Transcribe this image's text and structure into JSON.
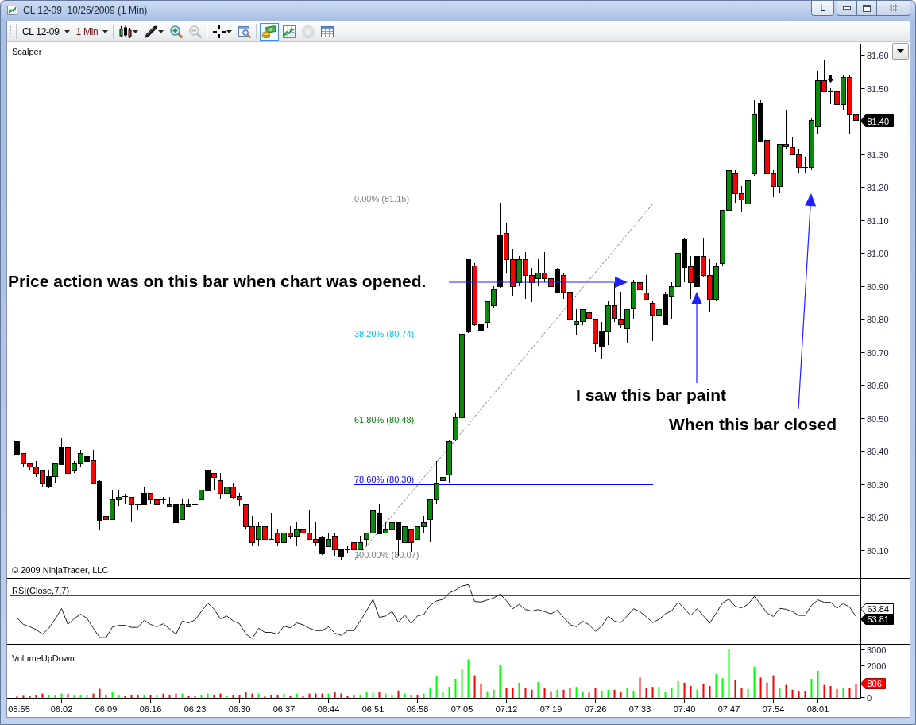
{
  "window": {
    "title": "CL 12-09  10/26/2009 (1 Min)",
    "buttons": [
      {
        "kind": "text",
        "label": "L"
      },
      {
        "kind": "minimize"
      },
      {
        "kind": "maximize"
      },
      {
        "kind": "close"
      }
    ]
  },
  "toolbar": {
    "instrument": "CL 12-09",
    "interval": "1 Min",
    "tool_groups": [
      [
        {
          "kind": "chart-style",
          "dropdown": true,
          "selected": false,
          "disabled": false
        },
        {
          "kind": "drawing-tools",
          "dropdown": true,
          "selected": false,
          "disabled": false
        },
        {
          "kind": "zoom-in",
          "dropdown": false,
          "selected": false,
          "disabled": false
        },
        {
          "kind": "zoom-out",
          "dropdown": false,
          "selected": false,
          "disabled": true
        }
      ],
      [
        {
          "kind": "cursor",
          "dropdown": true,
          "selected": false,
          "disabled": false
        },
        {
          "kind": "properties",
          "dropdown": false,
          "selected": false,
          "disabled": false
        }
      ],
      [
        {
          "kind": "strategies",
          "dropdown": false,
          "selected": true,
          "disabled": false
        },
        {
          "kind": "indicators",
          "dropdown": false,
          "selected": false,
          "disabled": false
        },
        {
          "kind": "orders",
          "dropdown": false,
          "selected": false,
          "disabled": true
        },
        {
          "kind": "data-box",
          "dropdown": false,
          "selected": false,
          "disabled": false
        }
      ]
    ]
  },
  "price_panel": {
    "indicator": "Scalper",
    "copyright": "© 2009 NinjaTrader, LLC",
    "axis_labels": [
      "81.60",
      "81.50",
      "81.30",
      "81.20",
      "81.10",
      "81.00",
      "80.90",
      "80.80",
      "80.70",
      "80.60",
      "80.50",
      "80.40",
      "80.30",
      "80.20",
      "80.10"
    ],
    "last_price": "81.40",
    "fibonacci": [
      {
        "label": "0.00% (81.15)",
        "color": "#808080"
      },
      {
        "label": "38.20% (80.74)",
        "color": "#00bfff"
      },
      {
        "label": "61.80% (80.48)",
        "color": "#008000"
      },
      {
        "label": "78.60% (80.30)",
        "color": "#0000ff"
      },
      {
        "label": "100.00% (80.07)",
        "color": "#808080"
      }
    ],
    "annotations": [
      {
        "text": "Price action was on this bar when chart was opened."
      },
      {
        "text": "I saw this bar paint"
      },
      {
        "text": "When this bar closed"
      }
    ]
  },
  "rsi_panel": {
    "label": "RSI(Close,7,7)",
    "readings": [
      {
        "text": "63.84",
        "kind": "outline"
      },
      {
        "text": "53.81",
        "kind": "solid"
      }
    ]
  },
  "volume_panel": {
    "label": "VolumeUpDown",
    "last_volume": "806",
    "chart_data": {
      "type": "bar",
      "categories": [
        "05:55",
        null,
        null,
        null,
        null,
        null,
        null,
        "06:02",
        null,
        null,
        null,
        null,
        null,
        null,
        "06:09",
        null,
        null,
        null,
        null,
        null,
        null,
        "06:16",
        null,
        null,
        null,
        null,
        null,
        null,
        "06:23",
        null,
        null,
        null,
        null,
        null,
        null,
        "06:30",
        null,
        null,
        null,
        null,
        null,
        null,
        "06:37",
        null,
        null,
        null,
        null,
        null,
        null,
        "06:44",
        null,
        null,
        null,
        null,
        null,
        null,
        "06:51",
        null,
        null,
        null,
        null,
        null,
        null,
        "06:58",
        null,
        null,
        null,
        null,
        null,
        null,
        "07:05",
        null,
        null,
        null,
        null,
        null,
        null,
        "07:12",
        null,
        null,
        null,
        null,
        null,
        null,
        "07:19",
        null,
        null,
        null,
        null,
        null,
        null,
        "07:26",
        null,
        null,
        null,
        null,
        null,
        null,
        "07:33",
        null,
        null,
        null,
        null,
        null,
        null,
        "07:40",
        null,
        null,
        null,
        null,
        null,
        null,
        "07:47",
        null,
        null,
        null,
        null,
        null,
        null,
        "07:54",
        null,
        null,
        null,
        null,
        null,
        null,
        "08:01",
        null,
        null,
        null,
        null,
        null,
        null
      ],
      "yticks": [
        0,
        2000,
        3000
      ],
      "ylim": [
        0,
        3300
      ],
      "series": [
        {
          "color": "#00ff00",
          "values": [
            null,
            null,
            null,
            null,
            null,
            150,
            150,
            220,
            null,
            150,
            150,
            150,
            null,
            null,
            null,
            330,
            150,
            null,
            null,
            null,
            150,
            null,
            150,
            null,
            null,
            null,
            220,
            null,
            null,
            150,
            220,
            null,
            null,
            90,
            null,
            null,
            null,
            null,
            220,
            null,
            null,
            null,
            220,
            null,
            220,
            null,
            null,
            null,
            null,
            220,
            null,
            null,
            null,
            null,
            150,
            330,
            280,
            null,
            220,
            150,
            null,
            220,
            150,
            null,
            220,
            610,
            1350,
            330,
            650,
            1150,
            1770,
            2380,
            null,
            null,
            370,
            460,
            2050,
            null,
            null,
            910,
            null,
            null,
            950,
            null,
            null,
            460,
            null,
            null,
            640,
            370,
            null,
            null,
            400,
            460,
            null,
            null,
            600,
            400,
            null,
            null,
            null,
            640,
            310,
            600,
            1000,
            null,
            null,
            460,
            null,
            null,
            1460,
            1190,
            3000,
            null,
            null,
            510,
            1920,
            null,
            null,
            null,
            600,
            null,
            null,
            null,
            null,
            1150,
            1650,
            null,
            null,
            null,
            550,
            null,
            null
          ]
        },
        {
          "color": "#ff0000",
          "values": [
            90,
            130,
            90,
            150,
            220,
            null,
            null,
            null,
            220,
            null,
            null,
            null,
            220,
            520,
            150,
            null,
            null,
            90,
            150,
            150,
            null,
            150,
            null,
            220,
            150,
            220,
            null,
            90,
            90,
            null,
            null,
            150,
            220,
            null,
            150,
            150,
            330,
            220,
            null,
            90,
            150,
            150,
            null,
            90,
            null,
            90,
            220,
            220,
            220,
            null,
            330,
            220,
            90,
            150,
            null,
            null,
            null,
            330,
            null,
            null,
            410,
            null,
            null,
            150,
            null,
            null,
            null,
            null,
            null,
            null,
            null,
            null,
            1370,
            860,
            null,
            null,
            null,
            600,
            600,
            null,
            550,
            460,
            null,
            550,
            370,
            null,
            460,
            550,
            null,
            null,
            280,
            550,
            null,
            null,
            460,
            310,
            null,
            null,
            1230,
            550,
            640,
            null,
            null,
            null,
            null,
            910,
            700,
            null,
            860,
            700,
            null,
            null,
            null,
            1100,
            550,
            null,
            null,
            1230,
            910,
            1370,
            null,
            770,
            460,
            400,
            400,
            null,
            null,
            770,
            700,
            510,
            null,
            600,
            806
          ]
        }
      ]
    }
  }
}
